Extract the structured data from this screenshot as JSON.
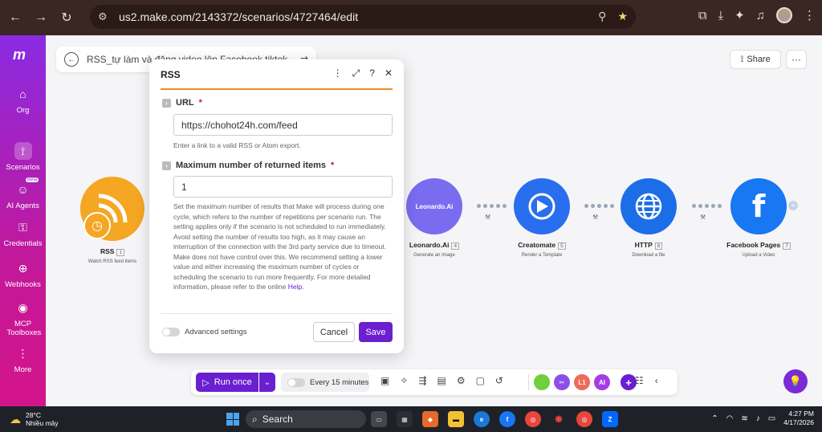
{
  "browser": {
    "url": "us2.make.com/2143372/scenarios/4727464/edit"
  },
  "sidebar": {
    "logo": "m",
    "items": [
      {
        "label": "Org",
        "icon": "home-icon"
      },
      {
        "label": "Scenarios",
        "icon": "share-nodes-icon"
      },
      {
        "label": "AI Agents",
        "icon": "ai-agent-icon",
        "badge": "Beta"
      },
      {
        "label": "Credentials",
        "icon": "key-icon"
      },
      {
        "label": "Webhooks",
        "icon": "globe-icon"
      },
      {
        "label": "MCP Toolboxes",
        "icon": "antenna-icon"
      },
      {
        "label": "More",
        "icon": "more-vertical-icon"
      }
    ]
  },
  "scenario": {
    "title": "RSS_tự làm và đăng video lên Facebook tiktok"
  },
  "header": {
    "share_label": "Share"
  },
  "modules": [
    {
      "name": "RSS",
      "num": "1",
      "desc": "Watch RSS feed items"
    },
    {
      "name": "Leonardo.Ai",
      "num": "4",
      "desc": "Generate an Image",
      "icon_text": "Leonardo.Ai"
    },
    {
      "name": "Creatomate",
      "num": "5",
      "desc": "Render a Template"
    },
    {
      "name": "HTTP",
      "num": "8",
      "desc": "Download a file"
    },
    {
      "name": "Facebook Pages",
      "num": "7",
      "desc": "Upload a Video"
    }
  ],
  "modal": {
    "title": "RSS",
    "url_label": "URL",
    "url_value": "https://chohot24h.com/feed",
    "url_hint": "Enter a link to a valid RSS or Atom export.",
    "max_label": "Maximum number of returned items",
    "max_value": "1",
    "max_hint": "Set the maximum number of results that Make will process during one cycle, which refers to the number of repetitions per scenario run. The setting applies only if the scenario is not scheduled to run immediately. Avoid setting the number of results too high, as it may cause an interruption of the connection with the 3rd party service due to timeout. Make does not have control over this. We recommend setting a lower value and either increasing the maximum number of cycles or scheduling the scenario to run more frequently. For more detailed information, please refer to the online",
    "help_link": "Help.",
    "advanced_label": "Advanced settings",
    "cancel_label": "Cancel",
    "save_label": "Save"
  },
  "toolbar": {
    "run_label": "Run once",
    "schedule_label": "Every 15 minutes",
    "apps": [
      {
        "text": "",
        "color": "#6fcf3f"
      },
      {
        "text": "",
        "color": "#8e4fe8"
      },
      {
        "text": "L1",
        "color": "#ee6a5a"
      },
      {
        "text": "AI",
        "color": "#a43ce8"
      }
    ]
  },
  "taskbar": {
    "weather_temp": "28°C",
    "weather_desc": "Nhiều mây",
    "search_label": "Search",
    "time": "4:27 PM",
    "date": "4/17/2026"
  }
}
